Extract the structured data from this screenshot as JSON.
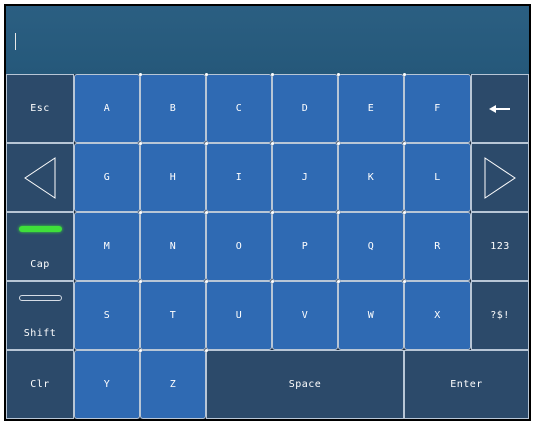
{
  "keyboard": {
    "input_value": "",
    "row1": {
      "esc": "Esc",
      "keys": [
        "A",
        "B",
        "C",
        "D",
        "E",
        "F"
      ],
      "backspace_icon": "arrow-left-icon"
    },
    "row2": {
      "left_icon": "triangle-left-icon",
      "keys": [
        "G",
        "H",
        "I",
        "J",
        "K",
        "L"
      ],
      "right_icon": "triangle-right-icon"
    },
    "row3": {
      "cap": "Cap",
      "cap_indicator": "on",
      "keys": [
        "M",
        "N",
        "O",
        "P",
        "Q",
        "R"
      ],
      "numbers": "123"
    },
    "row4": {
      "shift": "Shift",
      "shift_indicator": "off",
      "keys": [
        "S",
        "T",
        "U",
        "V",
        "W",
        "X"
      ],
      "symbols": "?$!"
    },
    "row5": {
      "clear": "Clr",
      "keys": [
        "Y",
        "Z"
      ],
      "space": "Space",
      "enter": "Enter"
    }
  },
  "colors": {
    "key_blue": "#2f6ab3",
    "key_dark": "#2c4a6a",
    "input_bg": "#2b5f82",
    "cap_on": "#3fe03a"
  }
}
